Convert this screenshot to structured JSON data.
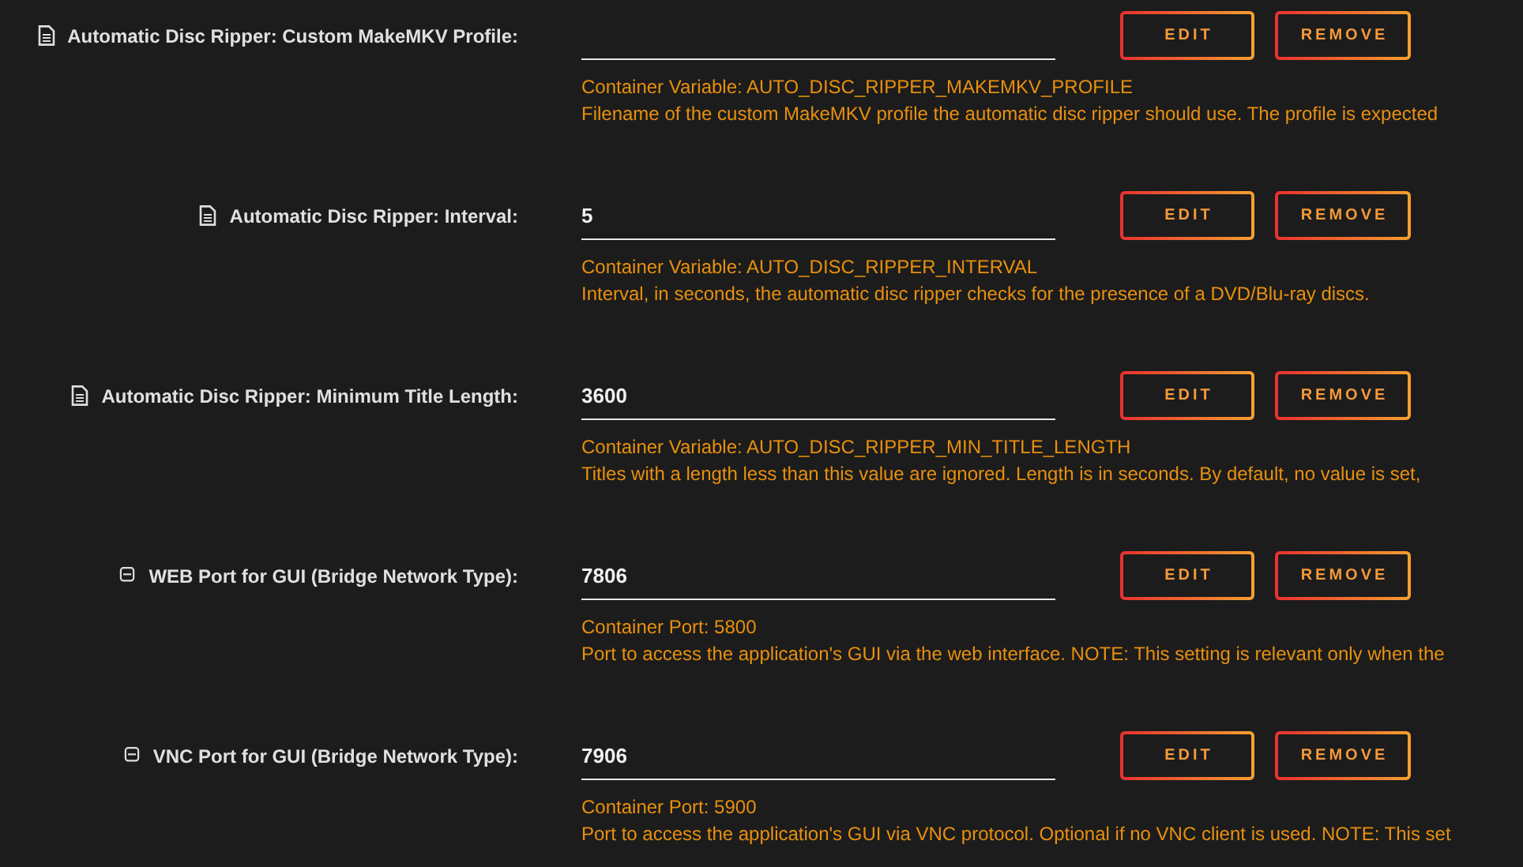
{
  "settings": [
    {
      "kind": "file",
      "label": "Automatic Disc Ripper: Custom MakeMKV Profile:",
      "container_info": "Container Variable: AUTO_DISC_RIPPER_MAKEMKV_PROFILE",
      "description": "Filename of the custom MakeMKV profile the automatic disc ripper should use. The profile is expected",
      "buttons": [
        "EDIT",
        "REMOVE"
      ]
    },
    {
      "kind": "file",
      "label": "Automatic Disc Ripper: Interval:",
      "value": "5",
      "container_info": "Container Variable: AUTO_DISC_RIPPER_INTERVAL",
      "description": "Interval, in seconds, the automatic disc ripper checks for the presence of a DVD/Blu-ray discs.",
      "buttons": [
        "EDIT",
        "REMOVE"
      ]
    },
    {
      "kind": "file",
      "label": "Automatic Disc Ripper: Minimum Title Length:",
      "value": "3600",
      "container_info": "Container Variable: AUTO_DISC_RIPPER_MIN_TITLE_LENGTH",
      "description": "Titles with a length less than this value are ignored. Length is in seconds. By default, no value is set,",
      "buttons": [
        "EDIT",
        "REMOVE"
      ]
    },
    {
      "kind": "port",
      "label": "WEB Port for GUI (Bridge Network Type):",
      "value": "7806",
      "container_info": "Container Port: 5800",
      "description": "Port to access the application's GUI via the web interface. NOTE: This setting is relevant only when the",
      "buttons": [
        "EDIT",
        "REMOVE"
      ]
    },
    {
      "kind": "port",
      "label": "VNC Port for GUI (Bridge Network Type):",
      "value": "7906",
      "container_info": "Container Port: 5900",
      "description": "Port to access the application's GUI via VNC protocol. Optional if no VNC client is used. NOTE: This set",
      "buttons": [
        "EDIT",
        "REMOVE"
      ]
    }
  ]
}
